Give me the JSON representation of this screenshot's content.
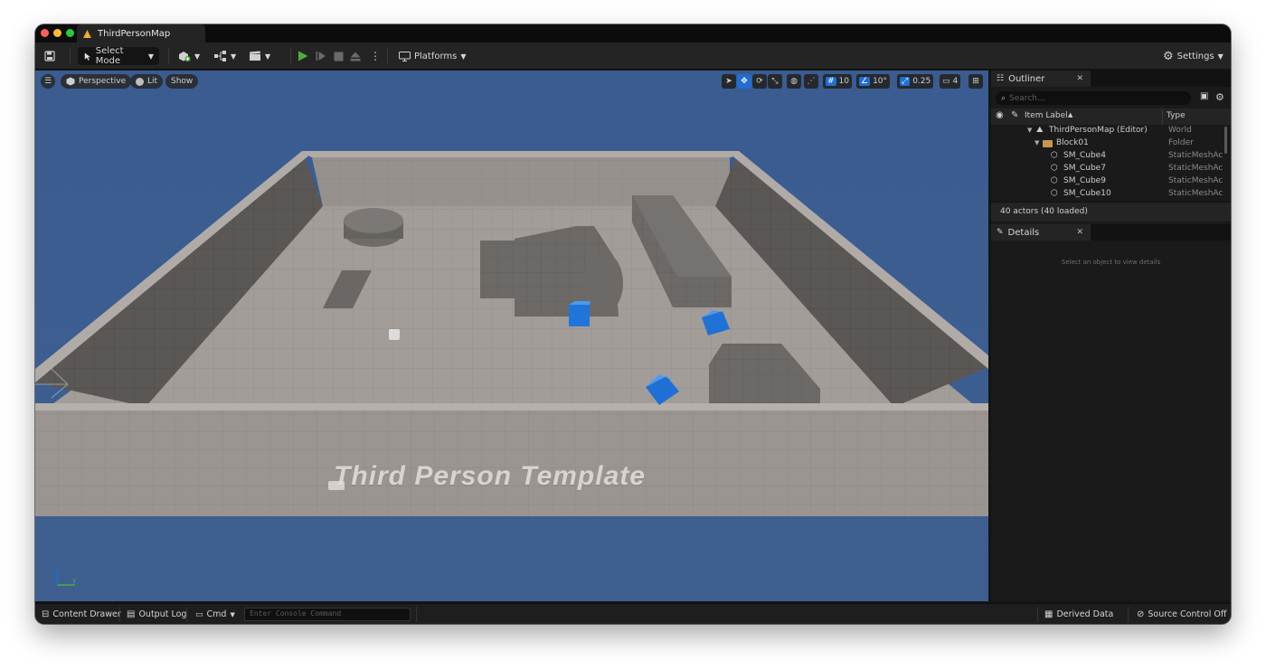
{
  "window": {
    "title": "ThirdPersonMap",
    "traffic_lights": [
      "#ff5f57",
      "#febc2e",
      "#28c840"
    ]
  },
  "toolbar": {
    "save_icon": "save-icon",
    "select_mode_label": "Select Mode",
    "platforms_label": "Platforms",
    "settings_label": "Settings",
    "play_color": "#4caf3a"
  },
  "viewport": {
    "perspective_label": "Perspective",
    "lit_label": "Lit",
    "show_label": "Show",
    "grid_snap_value": "10",
    "rotation_snap_value": "10°",
    "scale_snap_value": "0.25",
    "camera_speed_value": "4",
    "floor_text": "Third Person Template",
    "sky_color": "#3d5d8f",
    "accent_color": "#1f6ed4"
  },
  "outliner": {
    "tab_label": "Outliner",
    "search_placeholder": "Search...",
    "col_item_label": "Item Label",
    "col_type": "Type",
    "rows": [
      {
        "label": "ThirdPersonMap (Editor)",
        "type": "World"
      },
      {
        "label": "Block01",
        "type": "Folder"
      },
      {
        "label": "SM_Cube4",
        "type": "StaticMeshAc"
      },
      {
        "label": "SM_Cube7",
        "type": "StaticMeshAc"
      },
      {
        "label": "SM_Cube9",
        "type": "StaticMeshAc"
      },
      {
        "label": "SM_Cube10",
        "type": "StaticMeshAc"
      }
    ],
    "actor_count": "40 actors (40 loaded)"
  },
  "details": {
    "tab_label": "Details",
    "empty_message": "Select an object to view details"
  },
  "statusbar": {
    "content_drawer_label": "Content Drawer",
    "output_log_label": "Output Log",
    "cmd_label": "Cmd",
    "console_placeholder": "Enter Console Command",
    "derived_data_label": "Derived Data",
    "source_control_label": "Source Control Off"
  }
}
